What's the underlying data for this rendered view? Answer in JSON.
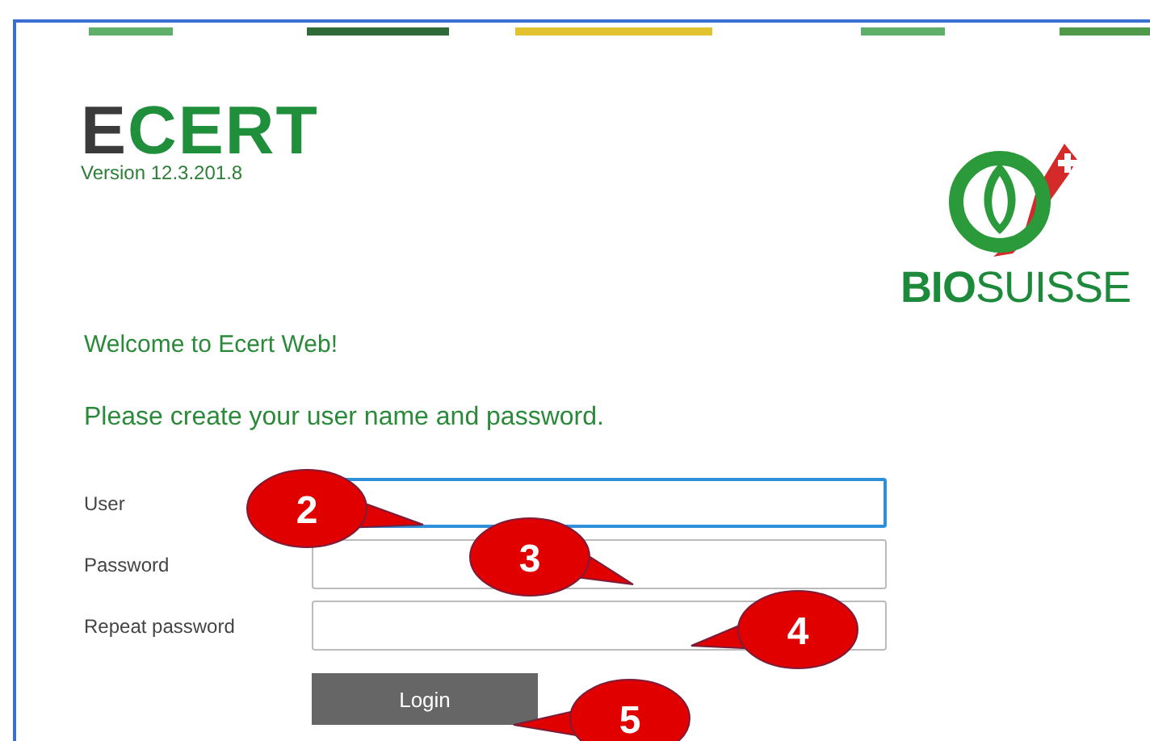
{
  "stripes": [
    {
      "color": "#5fae6a"
    },
    {
      "color": "#2f6b3a"
    },
    {
      "color": "#e3c22f"
    },
    {
      "color": "#5fae6a"
    },
    {
      "color": "#4e9a4a"
    }
  ],
  "brand": {
    "logo": "**E**CERT",
    "version": "Version 12.3.201.8",
    "partner": "**BIO**SUISSE"
  },
  "welcome": "Welcome to Ecert Web!",
  "instruction": "Please create your user name and password.",
  "fields": [
    {
      "label": "User",
      "focused": true
    },
    {
      "label": "Password",
      "focused": false
    },
    {
      "label": "Repeat password",
      "focused": false
    }
  ],
  "login_button": "Login",
  "callouts": [
    {
      "label": "2"
    },
    {
      "label": "3"
    },
    {
      "label": "4"
    },
    {
      "label": "5"
    }
  ]
}
